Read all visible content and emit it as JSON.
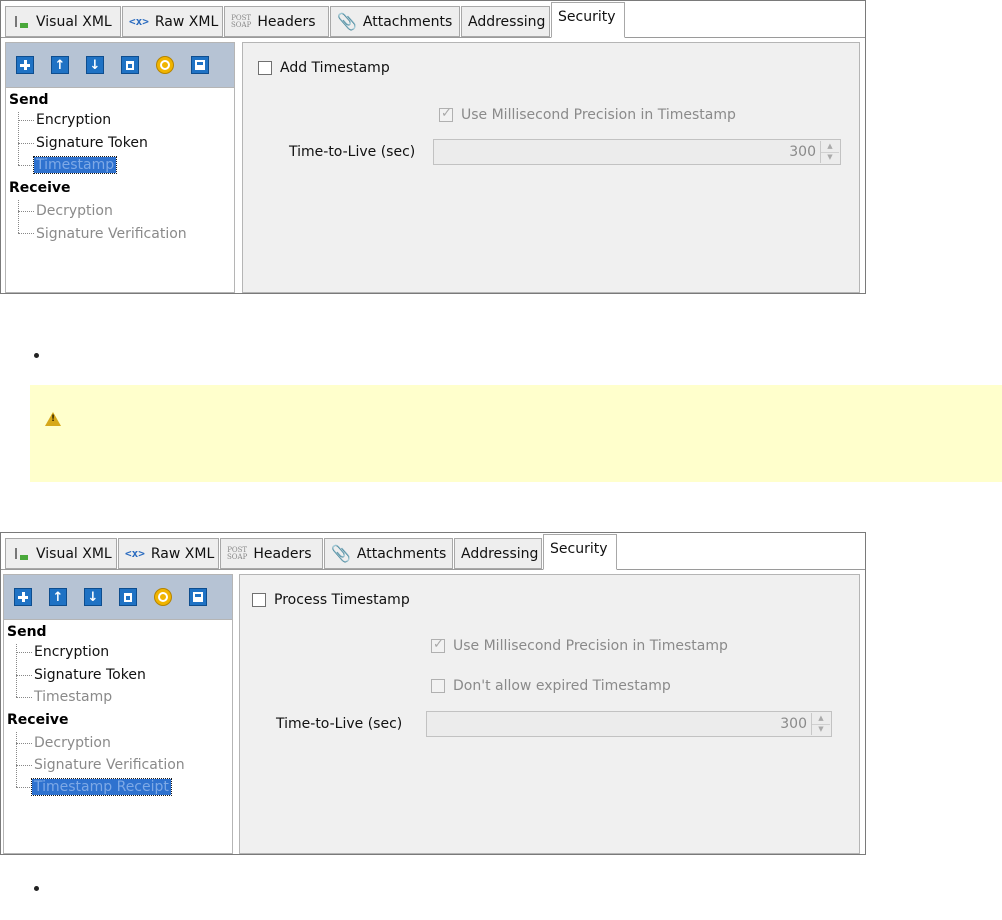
{
  "panels": [
    {
      "tabs": [
        {
          "label": "Visual XML",
          "icon": "visual-xml-icon",
          "active": false
        },
        {
          "label": "Raw XML",
          "icon": "raw-xml-icon",
          "icon_text": "<x>",
          "active": false
        },
        {
          "label": "Headers",
          "icon": "post-soap-icon",
          "icon_text": "POST SOAP",
          "active": false
        },
        {
          "label": "Attachments",
          "icon": "paperclip-icon",
          "active": false
        },
        {
          "label": "Addressing",
          "active": false
        },
        {
          "label": "Security",
          "active": true
        }
      ],
      "toolbar_buttons": [
        "add-icon",
        "move-up-icon",
        "move-down-icon",
        "delete-icon",
        "reset-icon",
        "save-icon"
      ],
      "tree": {
        "send_label": "Send",
        "send_items": [
          {
            "label": "Encryption",
            "state": "normal"
          },
          {
            "label": "Signature Token",
            "state": "normal"
          },
          {
            "label": "Timestamp",
            "state": "selected"
          }
        ],
        "receive_label": "Receive",
        "receive_items": [
          {
            "label": "Decryption",
            "state": "disabled"
          },
          {
            "label": "Signature Verification",
            "state": "disabled"
          }
        ]
      },
      "form": {
        "main_checkbox": {
          "label": "Add Timestamp",
          "checked": false
        },
        "millisecond_checkbox": {
          "label": "Use Millisecond Precision in Timestamp",
          "checked": true,
          "enabled": false
        },
        "ttl_label": "Time-to-Live (sec)",
        "ttl_value": "300"
      }
    },
    {
      "tabs": [
        {
          "label": "Visual XML",
          "icon": "visual-xml-icon",
          "active": false
        },
        {
          "label": "Raw XML",
          "icon": "raw-xml-icon",
          "icon_text": "<x>",
          "active": false
        },
        {
          "label": "Headers",
          "icon": "post-soap-icon",
          "icon_text": "POST SOAP",
          "active": false
        },
        {
          "label": "Attachments",
          "icon": "paperclip-icon",
          "active": false
        },
        {
          "label": "Addressing",
          "active": false
        },
        {
          "label": "Security",
          "active": true
        }
      ],
      "toolbar_buttons": [
        "add-icon",
        "move-up-icon",
        "move-down-icon",
        "delete-icon",
        "reset-icon",
        "save-icon"
      ],
      "tree": {
        "send_label": "Send",
        "send_items": [
          {
            "label": "Encryption",
            "state": "normal"
          },
          {
            "label": "Signature Token",
            "state": "normal"
          },
          {
            "label": "Timestamp",
            "state": "disabled"
          }
        ],
        "receive_label": "Receive",
        "receive_items": [
          {
            "label": "Decryption",
            "state": "disabled"
          },
          {
            "label": "Signature Verification",
            "state": "disabled"
          },
          {
            "label": "Timestamp Receipt",
            "state": "selected"
          }
        ]
      },
      "form": {
        "main_checkbox": {
          "label": "Process Timestamp",
          "checked": false
        },
        "millisecond_checkbox": {
          "label": "Use Millisecond Precision in Timestamp",
          "checked": true,
          "enabled": false
        },
        "expired_checkbox": {
          "label": "Don't allow expired Timestamp",
          "checked": false,
          "enabled": false
        },
        "ttl_label": "Time-to-Live (sec)",
        "ttl_value": "300"
      }
    }
  ],
  "warning": {
    "icon": "warning-icon"
  },
  "colors": {
    "selection": "#2f72cf",
    "toolbar": "#b6c3d4",
    "warning_bg": "#ffffcc",
    "warning_icon": "#d6a81a"
  }
}
